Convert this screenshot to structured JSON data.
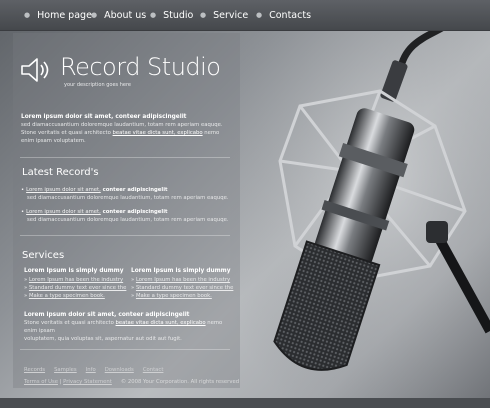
{
  "nav": [
    {
      "label": "Home page"
    },
    {
      "label": "About us"
    },
    {
      "label": "Studio"
    },
    {
      "label": "Service"
    },
    {
      "label": "Contacts"
    }
  ],
  "logo": {
    "title": "Record Studio",
    "tagline": "your description goes here",
    "icon": "speaker-icon"
  },
  "intro": {
    "heading": "Lorem ipsum dolor sit amet, conteer adipiscingelit",
    "line1": "sed diamaccusantium doloremque laudantium, totam rem aperiam eaquqe.",
    "line2_pre": "Stone veritatis et quasi architecto ",
    "line2_link": "beatae vitae dicta sunt, explicabo",
    "line2_post": " nemo",
    "line3": "enim ipsam voluptatem."
  },
  "latest": {
    "title": "Latest Record's",
    "items": [
      {
        "link": "Lorem ipsum dolor sit amet,",
        "bold": " conteer adipiscingelit",
        "desc": "sed diamaccusantium doloremque laudantium, totam rem aperiam eaquqe."
      },
      {
        "link": "Lorem ipsum dolor sit amet,",
        "bold": " conteer adipiscingelit",
        "desc": "sed diamaccusantium doloremque laudantium, totam rem aperiam eaquqe."
      }
    ]
  },
  "services": {
    "title": "Services",
    "columns": [
      {
        "heading": "Lorem Ipsum is simply dummy",
        "items": [
          "Lorem Ipsum has been the industry",
          "Standard dummy text ever since the",
          "Make a type specimen book."
        ]
      },
      {
        "heading": "Lorem Ipsum is simply dummy",
        "items": [
          "Lorem Ipsum has been the industry",
          "Standard dummy text ever since the",
          "Make a type specimen book."
        ]
      }
    ],
    "para_heading": "Lorem ipsum dolor sit amet, conteer adipiscingelit",
    "para_pre": "Stone veritatis et quasi architecto ",
    "para_link": "beatae vitae dicta sunt, explicabo",
    "para_post": " nemo enim ipsam",
    "para_line2": "voluptatem, quia voluptas sit,  aspernatur aut odit aut fugit."
  },
  "footer": {
    "links": [
      "Records",
      "Samples",
      "Info",
      "Downloads",
      "Contact"
    ],
    "terms": "Terms of Use",
    "sep": " | ",
    "privacy": "Privacy Statement",
    "copyright": "© 2008 Your Corporation. All rights reserved"
  },
  "colors": {
    "nav_bg": "#4f5256",
    "text": "#ffffff"
  }
}
